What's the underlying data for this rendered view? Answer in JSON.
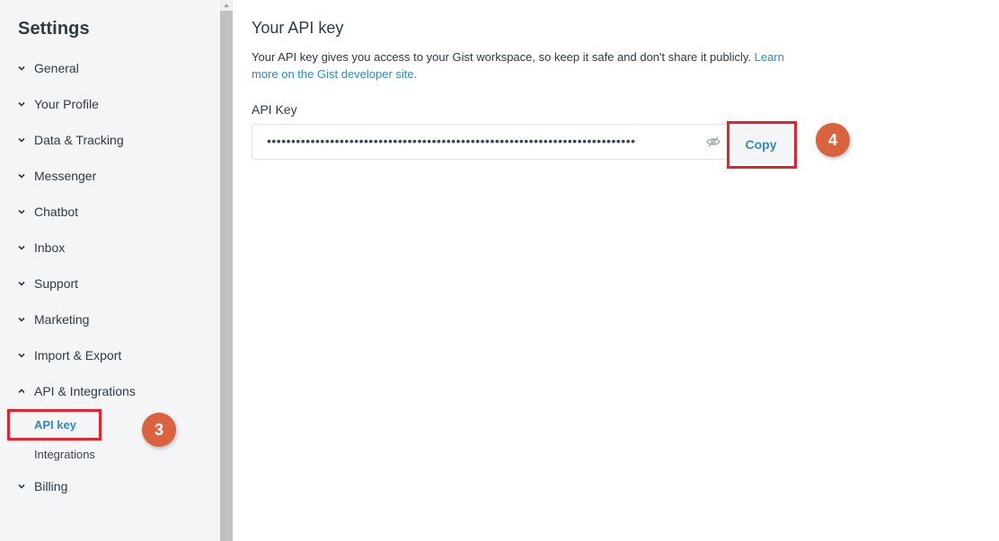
{
  "sidebar": {
    "title": "Settings",
    "items": [
      {
        "label": "General",
        "expanded": false
      },
      {
        "label": "Your Profile",
        "expanded": false
      },
      {
        "label": "Data & Tracking",
        "expanded": false
      },
      {
        "label": "Messenger",
        "expanded": false
      },
      {
        "label": "Chatbot",
        "expanded": false
      },
      {
        "label": "Inbox",
        "expanded": false
      },
      {
        "label": "Support",
        "expanded": false
      },
      {
        "label": "Marketing",
        "expanded": false
      },
      {
        "label": "Import & Export",
        "expanded": false
      },
      {
        "label": "API & Integrations",
        "expanded": true
      },
      {
        "label": "Billing",
        "expanded": false
      }
    ],
    "subitems": [
      {
        "label": "API key",
        "active": true
      },
      {
        "label": "Integrations",
        "active": false
      }
    ]
  },
  "main": {
    "title": "Your API key",
    "description_text": "Your API key gives you access to your Gist workspace, so keep it safe and don't share it publicly. ",
    "description_link": "Learn more on the Gist developer site.",
    "field_label": "API Key",
    "api_key_masked": "••••••••••••••••••••••••••••••••••••••••••••••••••••••••••••••••••••••••••••••••••••••••••••••••••",
    "copy_label": "Copy"
  },
  "annotations": {
    "step_api_key": "3",
    "step_copy": "4",
    "highlight_color": "#e8212d",
    "badge_color": "#d9623f"
  },
  "colors": {
    "accent": "#2b8ad8",
    "sidebar_bg": "#f4f5f6",
    "text": "#2d3a45"
  }
}
